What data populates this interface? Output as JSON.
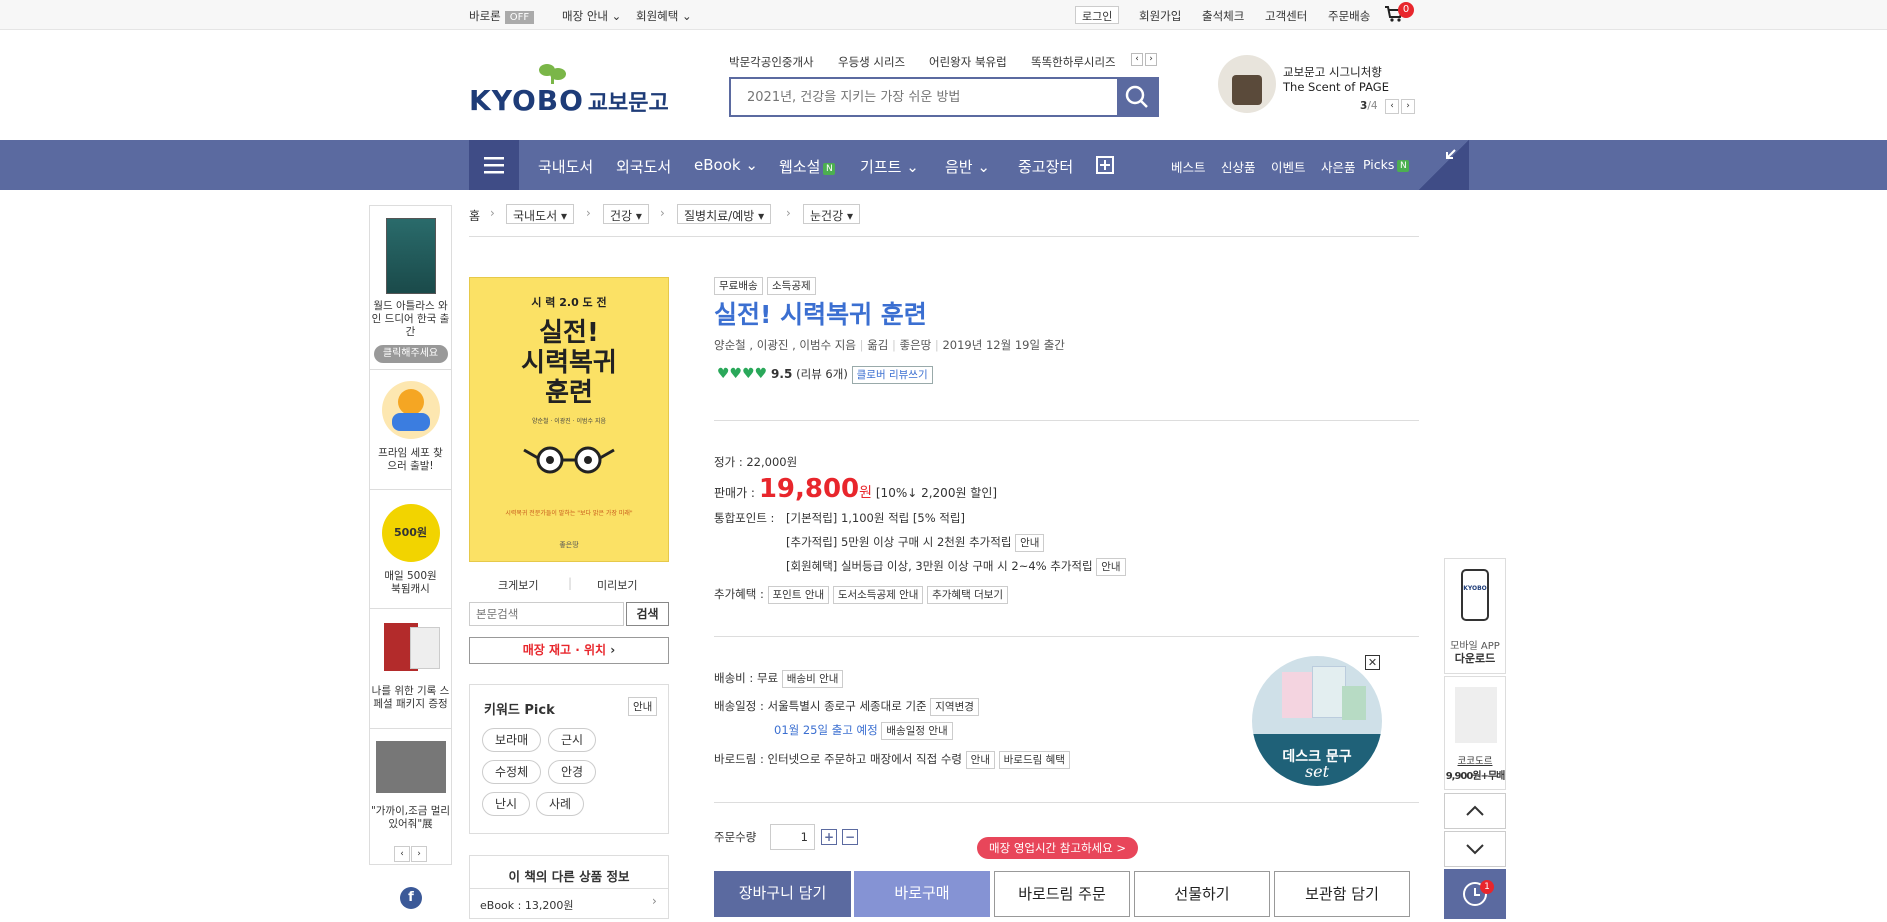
{
  "topbar": {
    "baroron": "바로론",
    "off": "OFF",
    "store_info": "매장 안내",
    "member_benefit": "회원혜택",
    "login": "로그인",
    "join": "회원가입",
    "attendance": "출석체크",
    "customer_center": "고객센터",
    "order_delivery": "주문배송",
    "cart_count": "0"
  },
  "header": {
    "logo_en": "KYOBO",
    "logo_ko": "교보문고",
    "series": [
      "박문각공인중개사",
      "우등생 시리즈",
      "어린왕자 북유럽",
      "똑똑한하루시리즈"
    ],
    "search_placeholder": "2021년, 건강을 지키는 가장 쉬운 방법",
    "promo_line1": "교보문고 시그니처향",
    "promo_line2": "The Scent of PAGE",
    "promo_page": "3",
    "promo_total": "/4"
  },
  "nav": {
    "items": [
      "국내도서",
      "외국도서",
      "eBook",
      "웹소설",
      "기프트",
      "음반",
      "중고장터"
    ],
    "new_badge": "N",
    "right_items": [
      "베스트",
      "신상품",
      "이벤트",
      "사은품",
      "Picks"
    ]
  },
  "leftbar": {
    "items": [
      {
        "label": "월드 아틀라스 와인 드디어 한국 출간",
        "cta": "클릭해주세요"
      },
      {
        "label": "프라임 세포 찾으러 출발!"
      },
      {
        "label": "매일 500원 북됨캐시",
        "coin": "500원"
      },
      {
        "label": "나를 위한 기록 스페셜 패키지 증정"
      },
      {
        "label": "\"가까이,조금 멀리 있어줘\"展"
      }
    ]
  },
  "breadcrumb": {
    "home": "홈",
    "levels": [
      "국내도서",
      "건강",
      "질병치료/예방",
      "눈건강"
    ]
  },
  "book": {
    "badges": [
      "무료배송",
      "소득공제"
    ],
    "title": "실전! 시력복귀 훈련",
    "authors": "양순철 , 이광진 , 이범수 지음",
    "publisher": "좋은땅",
    "pub_date": "2019년 12월 19일 출간",
    "sep": "|",
    "cover_top": "시 력 2.0 도 전",
    "cover_title1": "실전!",
    "cover_title2": "시력복귀",
    "cover_title3": "훈련",
    "cover_author": "양순철 · 이광진 · 이범수 지음",
    "cover_subtitle": "시력복귀 전문가들이 말하는 \"보다 밝은 가장 미래\"",
    "cover_pub": "좋은땅",
    "rating": "9.5",
    "reviews": "(리뷰 6개)",
    "write_review": "클로버 리뷰쓰기",
    "view_large": "크게보기",
    "preview": "미리보기",
    "text_search_placeholder": "본문검색",
    "text_search_btn": "검색",
    "stock_btn": "매장 재고 · 위치",
    "list_price_label": "정가 :",
    "list_price": "22,000원",
    "sale_label": "판매가 :",
    "sale_price": "19,800",
    "won": "원",
    "discount": "[10%↓ 2,200원 할인]",
    "points_label": "통합포인트 :",
    "points_basic": "[기본적립] 1,100원 적립 [5% 적립]",
    "points_extra": "[추가적립] 5만원 이상 구매 시 2천원 추가적립",
    "points_member": "[회원혜택] 실버등급 이상, 3만원 이상 구매 시 2~4% 추가적립",
    "guide": "안내",
    "extra_label": "추가혜택 :",
    "extra_btns": [
      "포인트 안내",
      "도서소득공제 안내",
      "추가혜택 더보기"
    ],
    "ship_fee_label": "배송비 :",
    "ship_fee": "무료",
    "ship_fee_btn": "배송비 안내",
    "ship_sched_label": "배송일정 :",
    "ship_sched": "서울특별시 종로구 세종대로 기준",
    "region_btn": "지역변경",
    "ship_date": "01월 25일 출고 예정",
    "ship_date_btn": "배송일정 안내",
    "barodream_label": "바로드림 :",
    "barodream": "인터넷으로 주문하고 매장에서 직접 수령",
    "barodream_btn": "바로드림 혜택",
    "qty_label": "주문수량",
    "qty": "1",
    "store_hours_pill": "매장 영업시간 참고하세요 >"
  },
  "keywords": {
    "title": "키워드 Pick",
    "guide": "안내",
    "chips": [
      "보라매",
      "근시",
      "수정체",
      "안경",
      "난시",
      "사례"
    ]
  },
  "other": {
    "title": "이 책의 다른 상품 정보",
    "ebook": "eBook : 13,200원"
  },
  "buttons": {
    "cart": "장바구니 담기",
    "buy": "바로구매",
    "barodream": "바로드림 주문",
    "gift": "선물하기",
    "wish": "보관함 담기"
  },
  "promo_circle": {
    "line1": "데스크 문구",
    "line2": "set"
  },
  "rightbar": {
    "app_line1": "모바일 APP",
    "app_line2": "다운로드",
    "ad_line1": "코코도르",
    "ad_line2": "9,900원+무배",
    "recent_count": "1"
  }
}
